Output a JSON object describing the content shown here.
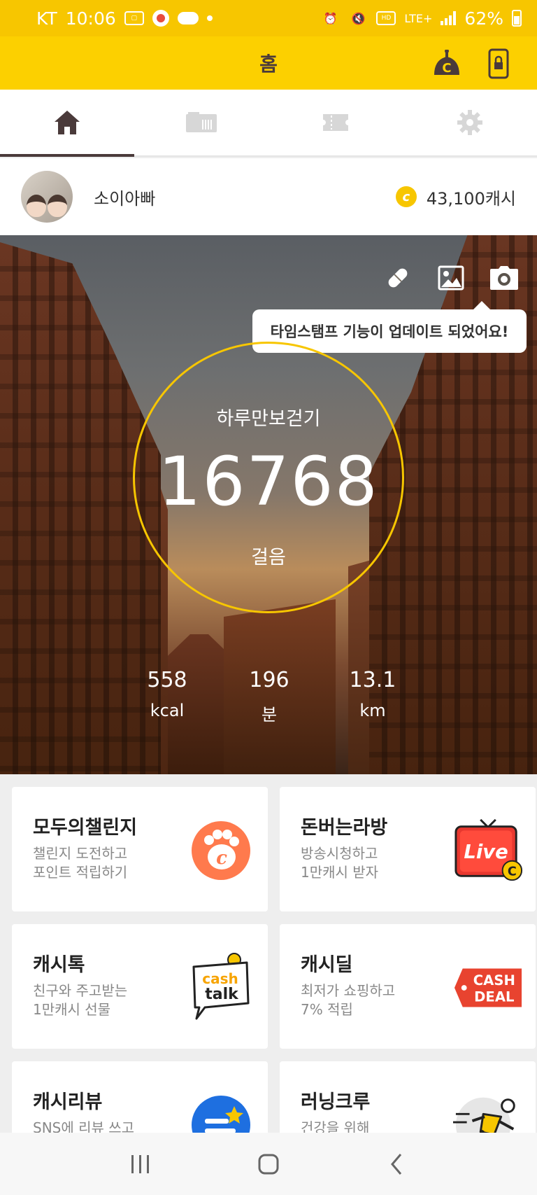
{
  "status_bar": {
    "carrier": "KT",
    "time": "10:06",
    "battery": "62%",
    "network": "LTE+"
  },
  "app_bar": {
    "title": "홈"
  },
  "tabs": [
    {
      "name": "home",
      "icon": "home-icon",
      "active": true
    },
    {
      "name": "ticket",
      "icon": "ticket-icon",
      "active": false
    },
    {
      "name": "coupon",
      "icon": "coupon-icon",
      "active": false
    },
    {
      "name": "settings",
      "icon": "gear-icon",
      "active": false
    }
  ],
  "profile": {
    "username": "소이아빠",
    "cash": "43,100캐시"
  },
  "hero": {
    "tooltip": "타임스탬프 기능이 업데이트 되었어요!",
    "steps_label": "하루만보걷기",
    "steps_value": "16768",
    "steps_unit": "걸음",
    "stats": [
      {
        "value": "558",
        "unit": "kcal"
      },
      {
        "value": "196",
        "unit": "분"
      },
      {
        "value": "13.1",
        "unit": "km"
      }
    ]
  },
  "cards": [
    {
      "title": "모두의챌린지",
      "sub1": "챌린지 도전하고",
      "sub2": "포인트 적립하기",
      "icon": "paw-coin-icon"
    },
    {
      "title": "돈버는라방",
      "sub1": "방송시청하고",
      "sub2": "1만캐시 받자",
      "icon": "live-tv-icon",
      "icon_text": "Live"
    },
    {
      "title": "캐시톡",
      "sub1": "친구와 주고받는",
      "sub2": "1만캐시 선물",
      "icon": "cash-talk-icon",
      "icon_text1": "cash",
      "icon_text2": "talk"
    },
    {
      "title": "캐시딜",
      "sub1": "최저가 쇼핑하고",
      "sub2": "7% 적립",
      "icon": "cash-deal-tag-icon",
      "icon_text1": "CASH",
      "icon_text2": "DEAL"
    },
    {
      "title": "캐시리뷰",
      "sub1": "SNS에 리뷰 쓰고",
      "sub2": "",
      "icon": "review-icon"
    },
    {
      "title": "러닝크루",
      "sub1": "건강을 위해",
      "sub2": "",
      "icon": "runner-icon"
    }
  ],
  "colors": {
    "primary_yellow": "#fcd000",
    "status_yellow": "#f7c600",
    "live_red": "#e8382f",
    "deal_red": "#e8432f",
    "paw_orange": "#ff7a4d",
    "review_blue": "#1e6fe0"
  }
}
